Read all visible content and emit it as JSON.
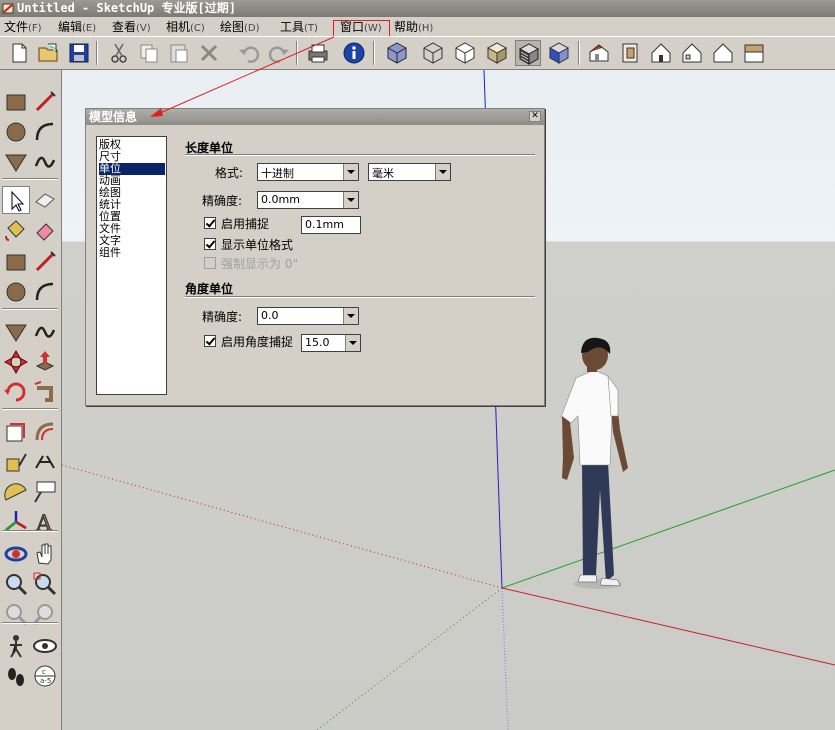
{
  "window": {
    "title": "Untitled - SketchUp 专业版[过期]"
  },
  "menu": [
    {
      "label": "文件",
      "accel": "(F)"
    },
    {
      "label": "编辑",
      "accel": "(E)"
    },
    {
      "label": "查看",
      "accel": "(V)"
    },
    {
      "label": "相机",
      "accel": "(C)"
    },
    {
      "label": "绘图",
      "accel": "(D)"
    },
    {
      "label": "工具",
      "accel": "(T)"
    },
    {
      "label": "窗口",
      "accel": "(W)"
    },
    {
      "label": "帮助",
      "accel": "(H)"
    }
  ],
  "toolbar": {
    "buttons": [
      "new-file-icon",
      "open-file-icon",
      "save-icon",
      "cut-icon",
      "copy-icon",
      "paste-icon",
      "erase-icon",
      "undo-icon",
      "redo-icon",
      "print-icon",
      "model-info-icon",
      "iso-view-icon",
      "top-view-icon",
      "front-view-icon",
      "right-view-icon",
      "back-view-icon",
      "left-view-icon",
      "xray-icon",
      "wireframe-icon",
      "hidden-line-icon",
      "shaded-icon",
      "shaded-texture-icon",
      "monochrome-icon"
    ]
  },
  "palette": {
    "tools": [
      "rectangle",
      "line",
      "circle",
      "arc",
      "polygon",
      "freehand",
      "select",
      "make-component",
      "paint-bucket",
      "eraser",
      "rectangle-2",
      "line-2",
      "circle-2",
      "arc-2",
      "polygon-2",
      "freehand-2",
      "move",
      "push-pull",
      "rotate",
      "follow-me",
      "scale",
      "offset",
      "tape-measure",
      "dimension",
      "protractor",
      "text",
      "axes",
      "3d-text",
      "orbit",
      "pan",
      "zoom",
      "zoom-window",
      "previous",
      "next",
      "walk",
      "look-around",
      "position-camera",
      "section-plane"
    ]
  },
  "dialog": {
    "title": "模型信息",
    "categories": [
      "版权",
      "尺寸",
      "单位",
      "动画",
      "绘图",
      "统计",
      "位置",
      "文件",
      "文字",
      "组件"
    ],
    "selected_category": "单位",
    "length_section": {
      "title": "长度单位",
      "format_label": "格式:",
      "format_value": "十进制",
      "unit_value": "毫米",
      "precision_label": "精确度:",
      "precision_value": "0.0mm",
      "snap_label": "启用捕捉",
      "snap_value": "0.1mm",
      "display_format_label": "显示单位格式",
      "force_display_label": "强制显示为 0\""
    },
    "angle_section": {
      "title": "角度单位",
      "precision_label": "精确度:",
      "precision_value": "0.0",
      "angle_snap_label": "启用角度捕捉",
      "angle_snap_value": "15.0"
    }
  },
  "colors": {
    "annotation_red": "#e02020",
    "axis_red": "#c8202a",
    "axis_green": "#20a020",
    "axis_blue": "#2020c8"
  }
}
